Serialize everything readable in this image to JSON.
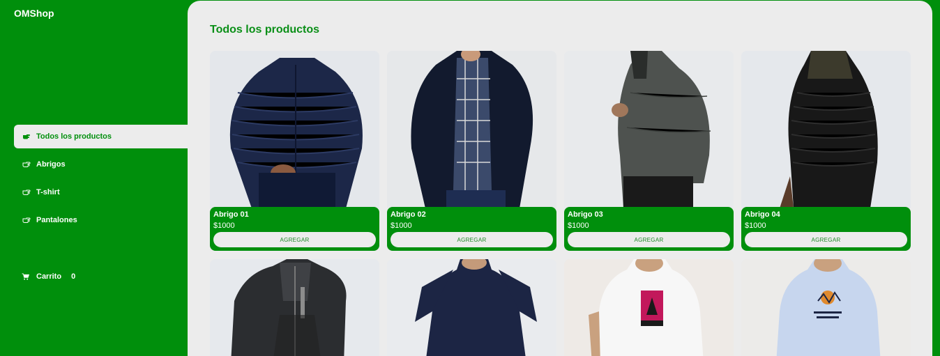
{
  "app": {
    "title": "OMShop"
  },
  "sidebar": {
    "items": [
      {
        "label": "Todos los productos",
        "icon": "hand-pointing-icon",
        "active": true
      },
      {
        "label": "Abrigos",
        "icon": "hand-pointing-outline-icon",
        "active": false
      },
      {
        "label": "T-shirt",
        "icon": "hand-pointing-outline-icon",
        "active": false
      },
      {
        "label": "Pantalones",
        "icon": "hand-pointing-outline-icon",
        "active": false
      }
    ],
    "cart": {
      "label": "Carrito",
      "count": "0",
      "icon": "cart-icon"
    }
  },
  "main": {
    "title": "Todos los productos",
    "products": [
      {
        "name": "Abrigo 01",
        "price": "$1000",
        "button": "AGREGAR"
      },
      {
        "name": "Abrigo 02",
        "price": "$1000",
        "button": "AGREGAR"
      },
      {
        "name": "Abrigo 03",
        "price": "$1000",
        "button": "AGREGAR"
      },
      {
        "name": "Abrigo 04",
        "price": "$1000",
        "button": "AGREGAR"
      },
      {
        "name": "",
        "price": "",
        "button": ""
      },
      {
        "name": "",
        "price": "",
        "button": ""
      },
      {
        "name": "",
        "price": "",
        "button": ""
      },
      {
        "name": "",
        "price": "",
        "button": ""
      }
    ]
  },
  "colors": {
    "brand": "#008f0c",
    "surface": "#ececec"
  }
}
